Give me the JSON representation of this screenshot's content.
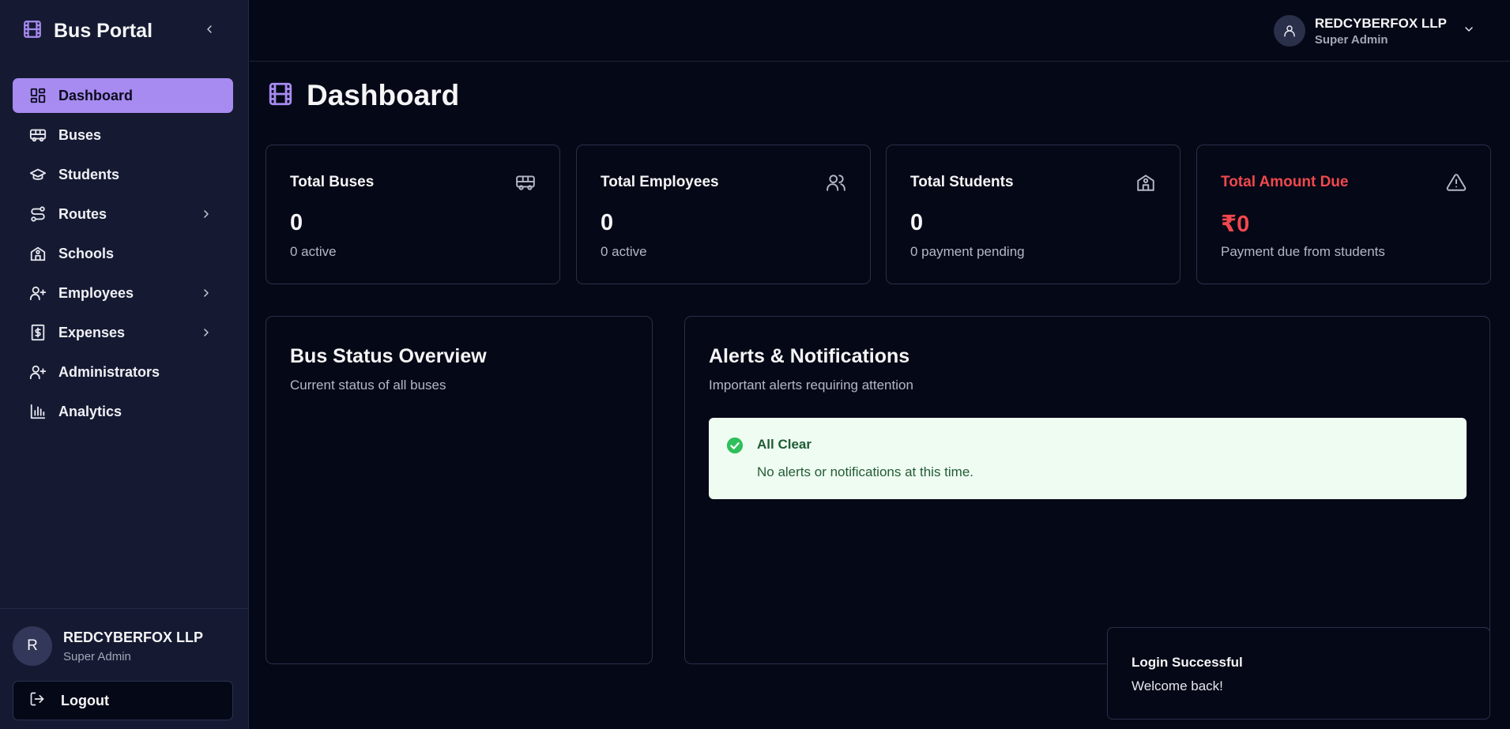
{
  "brand": {
    "title": "Bus Portal"
  },
  "colors": {
    "accent": "#a78bf0",
    "danger": "#f0484e",
    "success": "#2fbf5b"
  },
  "sidebar": {
    "items": [
      {
        "label": "Dashboard",
        "icon": "dashboard-grid-icon",
        "active": true
      },
      {
        "label": "Buses",
        "icon": "bus-icon"
      },
      {
        "label": "Students",
        "icon": "graduation-cap-icon"
      },
      {
        "label": "Routes",
        "icon": "route-icon",
        "expandable": true
      },
      {
        "label": "Schools",
        "icon": "school-icon"
      },
      {
        "label": "Employees",
        "icon": "user-plus-icon",
        "expandable": true
      },
      {
        "label": "Expenses",
        "icon": "receipt-dollar-icon",
        "expandable": true
      },
      {
        "label": "Administrators",
        "icon": "user-plus-icon"
      },
      {
        "label": "Analytics",
        "icon": "bar-chart-icon"
      }
    ],
    "user": {
      "initial": "R",
      "name": "REDCYBERFOX LLP",
      "role": "Super Admin"
    },
    "logout_label": "Logout"
  },
  "topbar": {
    "user_name": "REDCYBERFOX LLP",
    "user_role": "Super Admin"
  },
  "page": {
    "title": "Dashboard"
  },
  "stats": [
    {
      "title": "Total Buses",
      "value": "0",
      "sub": "0 active",
      "icon": "bus-icon"
    },
    {
      "title": "Total Employees",
      "value": "0",
      "sub": "0 active",
      "icon": "users-icon"
    },
    {
      "title": "Total Students",
      "value": "0",
      "sub": "0 payment pending",
      "icon": "school-icon"
    },
    {
      "title": "Total Amount Due",
      "value": "₹0",
      "sub": "Payment due from students",
      "icon": "warning-triangle-icon"
    }
  ],
  "bus_status": {
    "title": "Bus Status Overview",
    "subtitle": "Current status of all buses"
  },
  "alerts": {
    "title": "Alerts & Notifications",
    "subtitle": "Important alerts requiring attention",
    "all_clear_title": "All Clear",
    "all_clear_text": "No alerts or notifications at this time."
  },
  "toast": {
    "title": "Login Successful",
    "text": "Welcome back!"
  }
}
